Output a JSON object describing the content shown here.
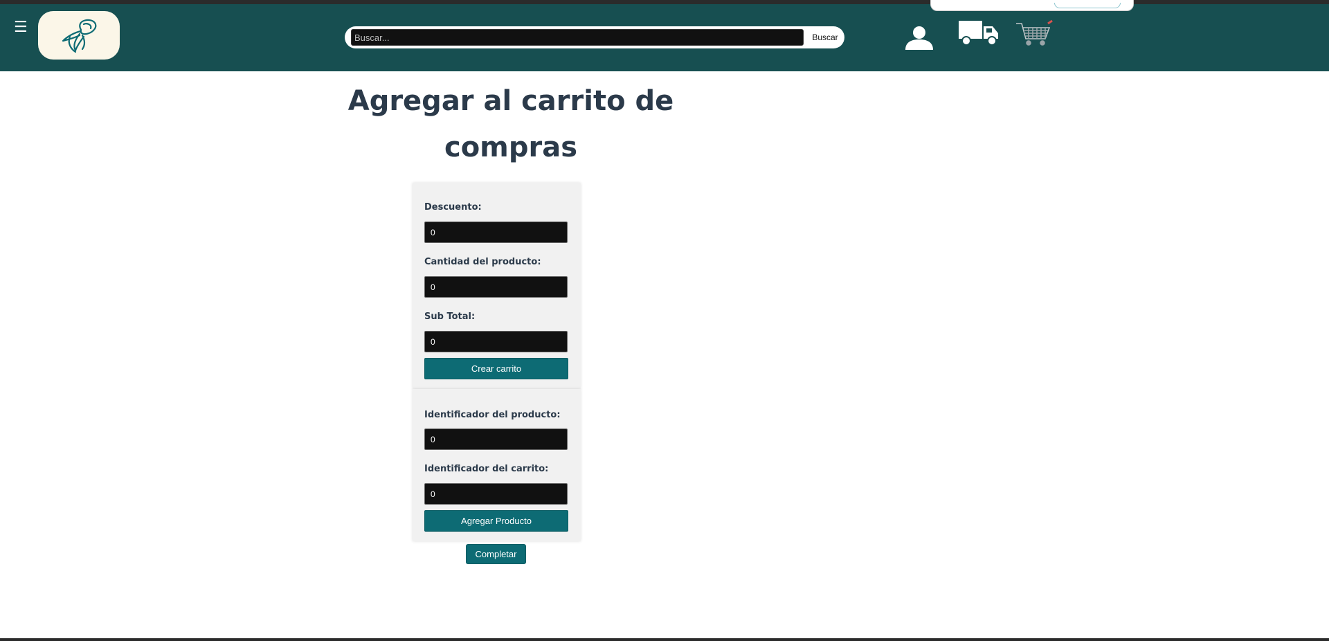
{
  "header": {
    "menu_icon": "hamburger-icon",
    "logo_icon": "sun-hat-logo",
    "search": {
      "placeholder": "Buscar...",
      "value": "",
      "button_label": "Buscar"
    },
    "icons": [
      "user-icon",
      "truck-icon",
      "cart-icon"
    ]
  },
  "main": {
    "title": "Agregar al carrito de compras",
    "cart_form": {
      "discount_label": "Descuento:",
      "discount_value": "0",
      "quantity_label": "Cantidad del producto:",
      "quantity_value": "0",
      "subtotal_label": "Sub Total:",
      "subtotal_value": "0",
      "create_button": "Crear carrito"
    },
    "product_form": {
      "product_id_label": "Identificador del producto:",
      "product_id_value": "0",
      "cart_id_label": "Identificador del carrito:",
      "cart_id_value": "0",
      "add_button": "Agregar Producto"
    },
    "complete_button": "Completar"
  },
  "colors": {
    "navbar": "#174f51",
    "logo_bg": "#fbf6e8",
    "button": "#0d6b74",
    "title_text": "#2b3a4a",
    "input_bg": "#111111",
    "panel_bg": "#f1f1f1"
  }
}
